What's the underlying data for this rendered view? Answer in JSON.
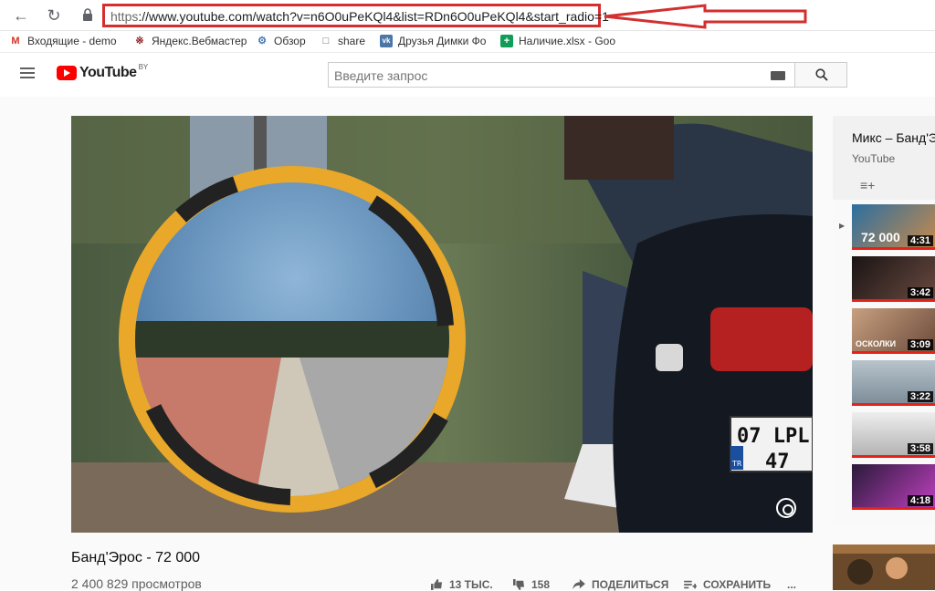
{
  "browser": {
    "url_protocol": "https",
    "url_rest": "://www.youtube.com/watch?v=n6O0uPeKQl4&list=RDn6O0uPeKQl4&start_radio=1",
    "bookmarks": [
      {
        "label": "Входящие - demo",
        "icon": "gmail-icon"
      },
      {
        "label": "Яндекс.Вебмастер",
        "icon": "yandex-webmaster-icon"
      },
      {
        "label": "Обзор",
        "icon": "settings-icon"
      },
      {
        "label": "share",
        "icon": "page-icon"
      },
      {
        "label": "Друзья Димки Фо",
        "icon": "vk-icon"
      },
      {
        "label": "Наличие.xlsx - Goo",
        "icon": "sheets-icon"
      }
    ],
    "accent_color": "#d32f2f"
  },
  "header": {
    "logo_text": "YouTube",
    "region": "BY",
    "search_placeholder": "Введите запрос"
  },
  "video": {
    "title": "Банд'Эрос - 72 000",
    "views": "2 400 829 просмотров",
    "plate_line1": "07 LPL",
    "plate_line2": "47",
    "plate_country": "TR",
    "actions": {
      "likes": "13 ТЫС.",
      "dislikes": "158",
      "share": "ПОДЕЛИТЬСЯ",
      "save": "СОХРАНИТЬ",
      "more": "..."
    }
  },
  "mix": {
    "title": "Микс – Банд'Э",
    "subtitle": "YouTube",
    "items": [
      {
        "duration": "4:31",
        "label": "72 000",
        "color": "#2b6fa0"
      },
      {
        "duration": "3:42",
        "label": "",
        "color": "#3a2a2a"
      },
      {
        "duration": "3:09",
        "label": "ОСКОЛКИ",
        "color": "#8a6a50"
      },
      {
        "duration": "3:22",
        "label": "",
        "color": "#9aa6b0"
      },
      {
        "duration": "3:58",
        "label": "",
        "color": "#d8d8d8"
      },
      {
        "duration": "4:18",
        "label": "",
        "color": "#5a2a7a"
      }
    ],
    "playing_marker": "▶"
  }
}
